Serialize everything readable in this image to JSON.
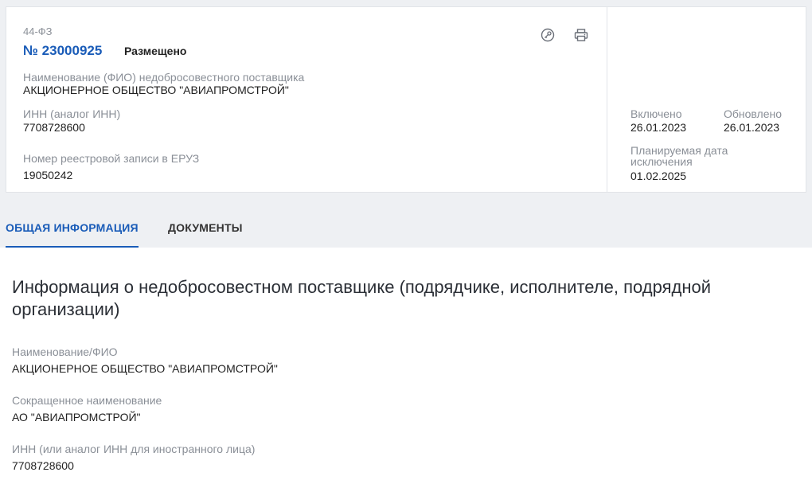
{
  "header": {
    "law": "44-ФЗ",
    "number": "№ 23000925",
    "status": "Размещено",
    "supplier_name_label": "Наименование (ФИО) недобросовестного поставщика",
    "supplier_name": "АКЦИОНЕРНОЕ ОБЩЕСТВО \"АВИАПРОМСТРОЙ\"",
    "inn_label": "ИНН (аналог ИНН)",
    "inn": "7708728600",
    "eruz_label": "Номер реестровой записи в ЕРУЗ",
    "eruz": "19050242",
    "icons": [
      "key-icon",
      "print-icon"
    ]
  },
  "dates": {
    "included_label": "Включено",
    "included": "26.01.2023",
    "updated_label": "Обновлено",
    "updated": "26.01.2023",
    "planned_exclusion_label_line1": "Планируемая дата",
    "planned_exclusion_label_line2": "исключения",
    "planned_exclusion": "01.02.2025"
  },
  "tabs": [
    {
      "label": "ОБЩАЯ ИНФОРМАЦИЯ",
      "active": true
    },
    {
      "label": "ДОКУМЕНТЫ",
      "active": false
    }
  ],
  "section": {
    "title": "Информация о недобросовестном поставщике (подрядчике, исполнителе, подрядной организации)",
    "fields": [
      {
        "label": "Наименование/ФИО",
        "value": "АКЦИОНЕРНОЕ ОБЩЕСТВО \"АВИАПРОМСТРОЙ\""
      },
      {
        "label": "Сокращенное наименование",
        "value": "АО \"АВИАПРОМСТРОЙ\""
      },
      {
        "label": "ИНН (или аналог ИНН для иностранного лица)",
        "value": "7708728600"
      }
    ]
  },
  "colors": {
    "accent": "#1a5cb8",
    "muted": "#8a8f97",
    "background": "#eef0f3"
  }
}
